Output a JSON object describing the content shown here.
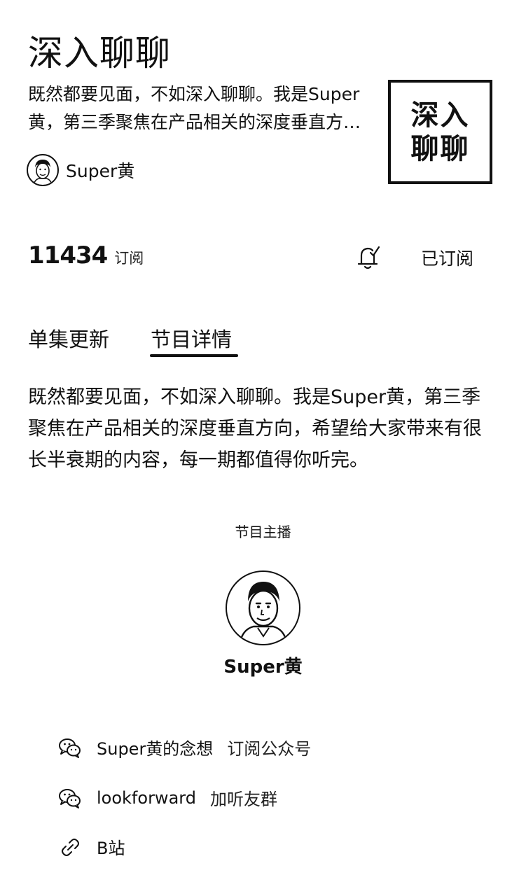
{
  "podcast": {
    "title": "深入聊聊",
    "description_short": "既然都要见面，不如深入聊聊。我是Super黄，第三季聚焦在产品相关的深度垂直方向，希望给大家带来有很长半衰期的内容，每一期都值得你听完。",
    "author": "Super黄",
    "cover_text_line1": "深入",
    "cover_text_line2": "聊聊"
  },
  "stats": {
    "subscriber_count": "11434",
    "subscriber_label": "订阅",
    "subscribe_status": "已订阅"
  },
  "tabs": [
    {
      "label": "单集更新",
      "active": false
    },
    {
      "label": "节目详情",
      "active": true
    }
  ],
  "details": {
    "description": "既然都要见面，不如深入聊聊。我是Super黄，第三季聚焦在产品相关的深度垂直方向，希望给大家带来有很长半衰期的内容，每一期都值得你听完。",
    "host_section_title": "节目主播",
    "host_name": "Super黄"
  },
  "links": [
    {
      "icon": "wechat-icon",
      "label": "Super黄的念想",
      "extra": "订阅公众号"
    },
    {
      "icon": "wechat-icon",
      "label": "lookforward",
      "extra": "加听友群"
    },
    {
      "icon": "link-icon",
      "label": "B站",
      "extra": ""
    }
  ]
}
